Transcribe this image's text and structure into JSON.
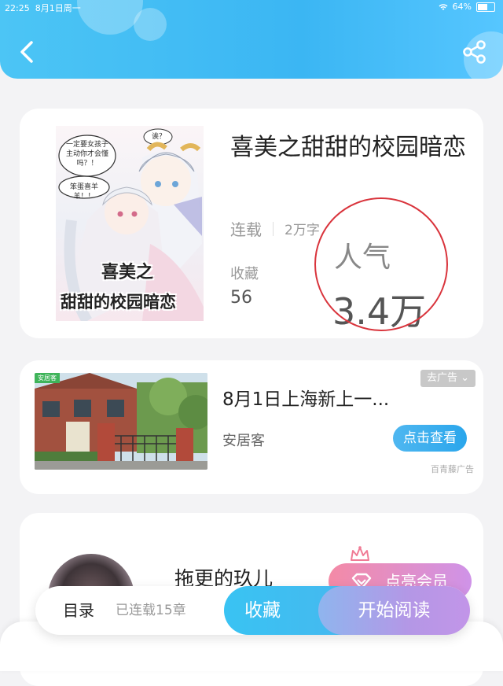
{
  "status_bar": {
    "time": "22:25",
    "date": "8月1日周一",
    "battery": "64%",
    "battery_level": 0.64
  },
  "header": {
    "back_icon": "chevron-left-icon",
    "share_icon": "share-icon"
  },
  "book": {
    "cover_title_line1": "喜美之",
    "cover_title_line2": "甜甜的校园暗恋",
    "cover_bubble_1": "一定要女孩子主动你才会懂吗？！",
    "cover_bubble_2": "笨蛋喜羊羊！！",
    "cover_bubble_3": "诶？",
    "title": "喜美之甜甜的校园暗恋",
    "status": "连载",
    "word_count": "2万字",
    "favorites_label": "收藏",
    "favorites_value": "56",
    "popularity_label": "人气",
    "popularity_value": "3.4万"
  },
  "ad": {
    "badge": "安居客",
    "title": "8月1日上海新上一...",
    "source": "安居客",
    "remove_label": "去广告",
    "cta_label": "点击查看",
    "brand": "百青藤广告"
  },
  "author": {
    "name": "拖更的玖儿",
    "vip_label": "点亮会员"
  },
  "bottom_bar": {
    "toc_label": "目录",
    "chapter_count": "已连载15章",
    "favorite_label": "收藏",
    "read_label": "开始阅读"
  },
  "colors": {
    "accent": "#3bb6f3",
    "highlight_circle": "#d9343c"
  }
}
